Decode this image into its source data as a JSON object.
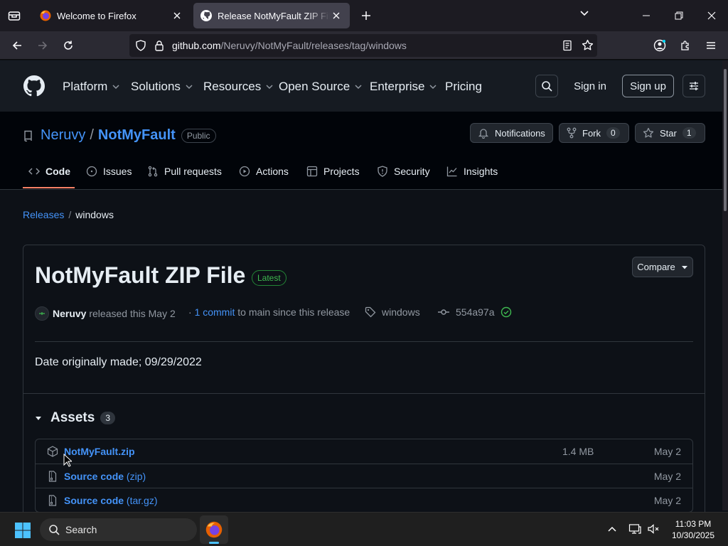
{
  "browser": {
    "tabs": [
      {
        "title": "Welcome to Firefox",
        "active": false
      },
      {
        "title": "Release NotMyFault ZIP File · Ne",
        "active": true
      }
    ],
    "url": {
      "domain": "github.com",
      "path": "/Neruvy/NotMyFault/releases/tag/windows"
    }
  },
  "github": {
    "nav": [
      "Platform",
      "Solutions",
      "Resources",
      "Open Source",
      "Enterprise",
      "Pricing"
    ],
    "sign_in": "Sign in",
    "sign_up": "Sign up"
  },
  "repo": {
    "owner": "Neruvy",
    "separator": "/",
    "name": "NotMyFault",
    "visibility": "Public",
    "notifications": "Notifications",
    "fork": "Fork",
    "fork_count": "0",
    "star": "Star",
    "star_count": "1",
    "tabs": [
      "Code",
      "Issues",
      "Pull requests",
      "Actions",
      "Projects",
      "Security",
      "Insights"
    ]
  },
  "breadcrumb": {
    "releases": "Releases",
    "separator": "/",
    "current": "windows"
  },
  "release": {
    "title": "NotMyFault ZIP File",
    "badge": "Latest",
    "compare": "Compare",
    "author": "Neruvy",
    "released_text": "released this May 2",
    "bullet": "·",
    "commits_link": "1 commit",
    "commits_text": "to main since this release",
    "tag": "windows",
    "commit_sha": "554a97a",
    "description": "Date originally made; 09/29/2022"
  },
  "assets": {
    "title": "Assets",
    "count": "3",
    "items": [
      {
        "name": "NotMyFault.zip",
        "suffix": "",
        "size": "1.4 MB",
        "date": "May 2",
        "icon": "package-icon"
      },
      {
        "name": "Source code",
        "suffix": "(zip)",
        "size": "",
        "date": "May 2",
        "icon": "file-zip-icon"
      },
      {
        "name": "Source code",
        "suffix": "(tar.gz)",
        "size": "",
        "date": "May 2",
        "icon": "file-zip-icon"
      }
    ]
  },
  "taskbar": {
    "search_label": "Search",
    "time": "11:03 PM",
    "date": "10/30/2025"
  },
  "colors": {
    "accent_link": "#4493f8",
    "latest_green": "#3fb950",
    "code_underline": "#f78166",
    "page_bg": "#0d1117"
  }
}
